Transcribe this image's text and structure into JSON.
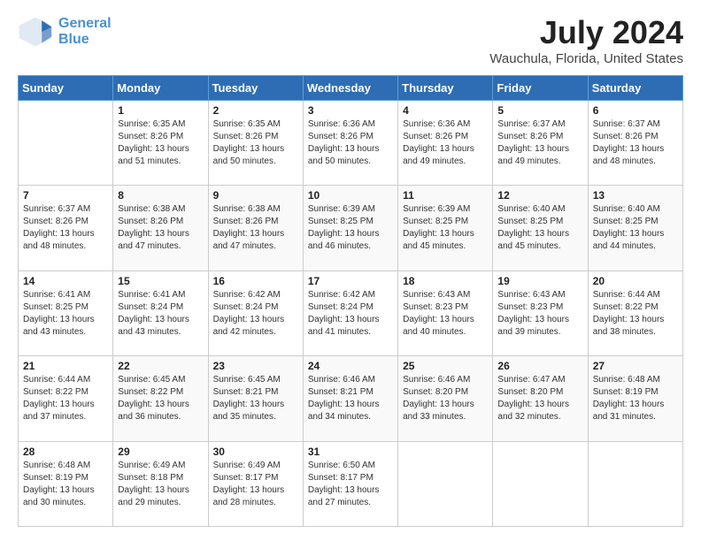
{
  "header": {
    "logo_line1": "General",
    "logo_line2": "Blue",
    "title": "July 2024",
    "subtitle": "Wauchula, Florida, United States"
  },
  "columns": [
    "Sunday",
    "Monday",
    "Tuesday",
    "Wednesday",
    "Thursday",
    "Friday",
    "Saturday"
  ],
  "weeks": [
    [
      {
        "day": "",
        "info": ""
      },
      {
        "day": "1",
        "info": "Sunrise: 6:35 AM\nSunset: 8:26 PM\nDaylight: 13 hours\nand 51 minutes."
      },
      {
        "day": "2",
        "info": "Sunrise: 6:35 AM\nSunset: 8:26 PM\nDaylight: 13 hours\nand 50 minutes."
      },
      {
        "day": "3",
        "info": "Sunrise: 6:36 AM\nSunset: 8:26 PM\nDaylight: 13 hours\nand 50 minutes."
      },
      {
        "day": "4",
        "info": "Sunrise: 6:36 AM\nSunset: 8:26 PM\nDaylight: 13 hours\nand 49 minutes."
      },
      {
        "day": "5",
        "info": "Sunrise: 6:37 AM\nSunset: 8:26 PM\nDaylight: 13 hours\nand 49 minutes."
      },
      {
        "day": "6",
        "info": "Sunrise: 6:37 AM\nSunset: 8:26 PM\nDaylight: 13 hours\nand 48 minutes."
      }
    ],
    [
      {
        "day": "7",
        "info": "Sunrise: 6:37 AM\nSunset: 8:26 PM\nDaylight: 13 hours\nand 48 minutes."
      },
      {
        "day": "8",
        "info": "Sunrise: 6:38 AM\nSunset: 8:26 PM\nDaylight: 13 hours\nand 47 minutes."
      },
      {
        "day": "9",
        "info": "Sunrise: 6:38 AM\nSunset: 8:26 PM\nDaylight: 13 hours\nand 47 minutes."
      },
      {
        "day": "10",
        "info": "Sunrise: 6:39 AM\nSunset: 8:25 PM\nDaylight: 13 hours\nand 46 minutes."
      },
      {
        "day": "11",
        "info": "Sunrise: 6:39 AM\nSunset: 8:25 PM\nDaylight: 13 hours\nand 45 minutes."
      },
      {
        "day": "12",
        "info": "Sunrise: 6:40 AM\nSunset: 8:25 PM\nDaylight: 13 hours\nand 45 minutes."
      },
      {
        "day": "13",
        "info": "Sunrise: 6:40 AM\nSunset: 8:25 PM\nDaylight: 13 hours\nand 44 minutes."
      }
    ],
    [
      {
        "day": "14",
        "info": "Sunrise: 6:41 AM\nSunset: 8:25 PM\nDaylight: 13 hours\nand 43 minutes."
      },
      {
        "day": "15",
        "info": "Sunrise: 6:41 AM\nSunset: 8:24 PM\nDaylight: 13 hours\nand 43 minutes."
      },
      {
        "day": "16",
        "info": "Sunrise: 6:42 AM\nSunset: 8:24 PM\nDaylight: 13 hours\nand 42 minutes."
      },
      {
        "day": "17",
        "info": "Sunrise: 6:42 AM\nSunset: 8:24 PM\nDaylight: 13 hours\nand 41 minutes."
      },
      {
        "day": "18",
        "info": "Sunrise: 6:43 AM\nSunset: 8:23 PM\nDaylight: 13 hours\nand 40 minutes."
      },
      {
        "day": "19",
        "info": "Sunrise: 6:43 AM\nSunset: 8:23 PM\nDaylight: 13 hours\nand 39 minutes."
      },
      {
        "day": "20",
        "info": "Sunrise: 6:44 AM\nSunset: 8:22 PM\nDaylight: 13 hours\nand 38 minutes."
      }
    ],
    [
      {
        "day": "21",
        "info": "Sunrise: 6:44 AM\nSunset: 8:22 PM\nDaylight: 13 hours\nand 37 minutes."
      },
      {
        "day": "22",
        "info": "Sunrise: 6:45 AM\nSunset: 8:22 PM\nDaylight: 13 hours\nand 36 minutes."
      },
      {
        "day": "23",
        "info": "Sunrise: 6:45 AM\nSunset: 8:21 PM\nDaylight: 13 hours\nand 35 minutes."
      },
      {
        "day": "24",
        "info": "Sunrise: 6:46 AM\nSunset: 8:21 PM\nDaylight: 13 hours\nand 34 minutes."
      },
      {
        "day": "25",
        "info": "Sunrise: 6:46 AM\nSunset: 8:20 PM\nDaylight: 13 hours\nand 33 minutes."
      },
      {
        "day": "26",
        "info": "Sunrise: 6:47 AM\nSunset: 8:20 PM\nDaylight: 13 hours\nand 32 minutes."
      },
      {
        "day": "27",
        "info": "Sunrise: 6:48 AM\nSunset: 8:19 PM\nDaylight: 13 hours\nand 31 minutes."
      }
    ],
    [
      {
        "day": "28",
        "info": "Sunrise: 6:48 AM\nSunset: 8:19 PM\nDaylight: 13 hours\nand 30 minutes."
      },
      {
        "day": "29",
        "info": "Sunrise: 6:49 AM\nSunset: 8:18 PM\nDaylight: 13 hours\nand 29 minutes."
      },
      {
        "day": "30",
        "info": "Sunrise: 6:49 AM\nSunset: 8:17 PM\nDaylight: 13 hours\nand 28 minutes."
      },
      {
        "day": "31",
        "info": "Sunrise: 6:50 AM\nSunset: 8:17 PM\nDaylight: 13 hours\nand 27 minutes."
      },
      {
        "day": "",
        "info": ""
      },
      {
        "day": "",
        "info": ""
      },
      {
        "day": "",
        "info": ""
      }
    ]
  ]
}
